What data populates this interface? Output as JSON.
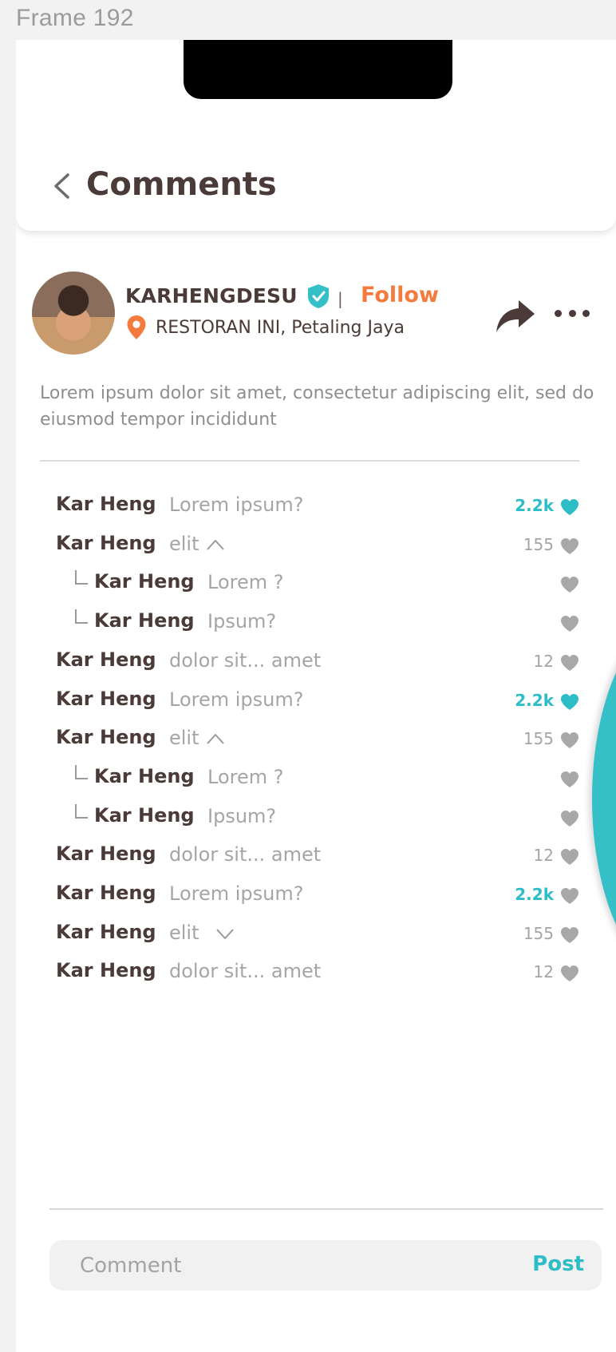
{
  "frame_label": "Frame 192",
  "header": {
    "title": "Comments"
  },
  "post": {
    "username": "KARHENGDESU",
    "separator": "|",
    "follow_label": "Follow",
    "location": "RESTORAN INI, Petaling Jaya",
    "caption": "Lorem ipsum dolor sit amet, consectetur adipiscing elit, sed do eiusmod tempor incididunt"
  },
  "comments": [
    {
      "name": "Kar Heng",
      "text": "Lorem ipsum?",
      "likes": "2.2k",
      "liked": true,
      "reply": false,
      "chevron": ""
    },
    {
      "name": "Kar Heng",
      "text": "elit",
      "likes": "155",
      "liked": false,
      "reply": false,
      "chevron": "up"
    },
    {
      "name": "Kar Heng",
      "text": "Lorem ?",
      "likes": "",
      "liked": false,
      "reply": true,
      "chevron": ""
    },
    {
      "name": "Kar Heng",
      "text": "Ipsum?",
      "likes": "",
      "liked": false,
      "reply": true,
      "chevron": ""
    },
    {
      "name": "Kar Heng",
      "text": "dolor sit... amet",
      "likes": "12",
      "liked": false,
      "reply": false,
      "chevron": ""
    },
    {
      "name": "Kar Heng",
      "text": "Lorem ipsum?",
      "likes": "2.2k",
      "liked": true,
      "reply": false,
      "chevron": ""
    },
    {
      "name": "Kar Heng",
      "text": "elit",
      "likes": "155",
      "liked": false,
      "reply": false,
      "chevron": "up"
    },
    {
      "name": "Kar Heng",
      "text": "Lorem ?",
      "likes": "",
      "liked": false,
      "reply": true,
      "chevron": ""
    },
    {
      "name": "Kar Heng",
      "text": "Ipsum?",
      "likes": "",
      "liked": false,
      "reply": true,
      "chevron": ""
    },
    {
      "name": "Kar Heng",
      "text": "dolor sit... amet",
      "likes": "12",
      "liked": false,
      "reply": false,
      "chevron": ""
    },
    {
      "name": "Kar Heng",
      "text": "Lorem ipsum?",
      "likes": "2.2k",
      "liked": false,
      "reply": false,
      "chevron": ""
    },
    {
      "name": "Kar Heng",
      "text": "elit",
      "likes": "155",
      "liked": false,
      "reply": false,
      "chevron": "down"
    },
    {
      "name": "Kar Heng",
      "text": "dolor sit... amet",
      "likes": "12",
      "liked": false,
      "reply": false,
      "chevron": ""
    }
  ],
  "composer": {
    "placeholder": "Comment",
    "post_label": "Post"
  },
  "colors": {
    "accent_teal": "#2cbdc6",
    "follow_orange": "#f47b3e",
    "text_dark": "#4a3a38",
    "text_muted": "#a5a5a5",
    "heart_grey": "#a8a8a8"
  },
  "icons": [
    "back-chevron-icon",
    "verified-badge-icon",
    "location-pin-icon",
    "share-icon",
    "more-icon",
    "heart-icon",
    "chevron-up-icon",
    "chevron-down-icon"
  ]
}
